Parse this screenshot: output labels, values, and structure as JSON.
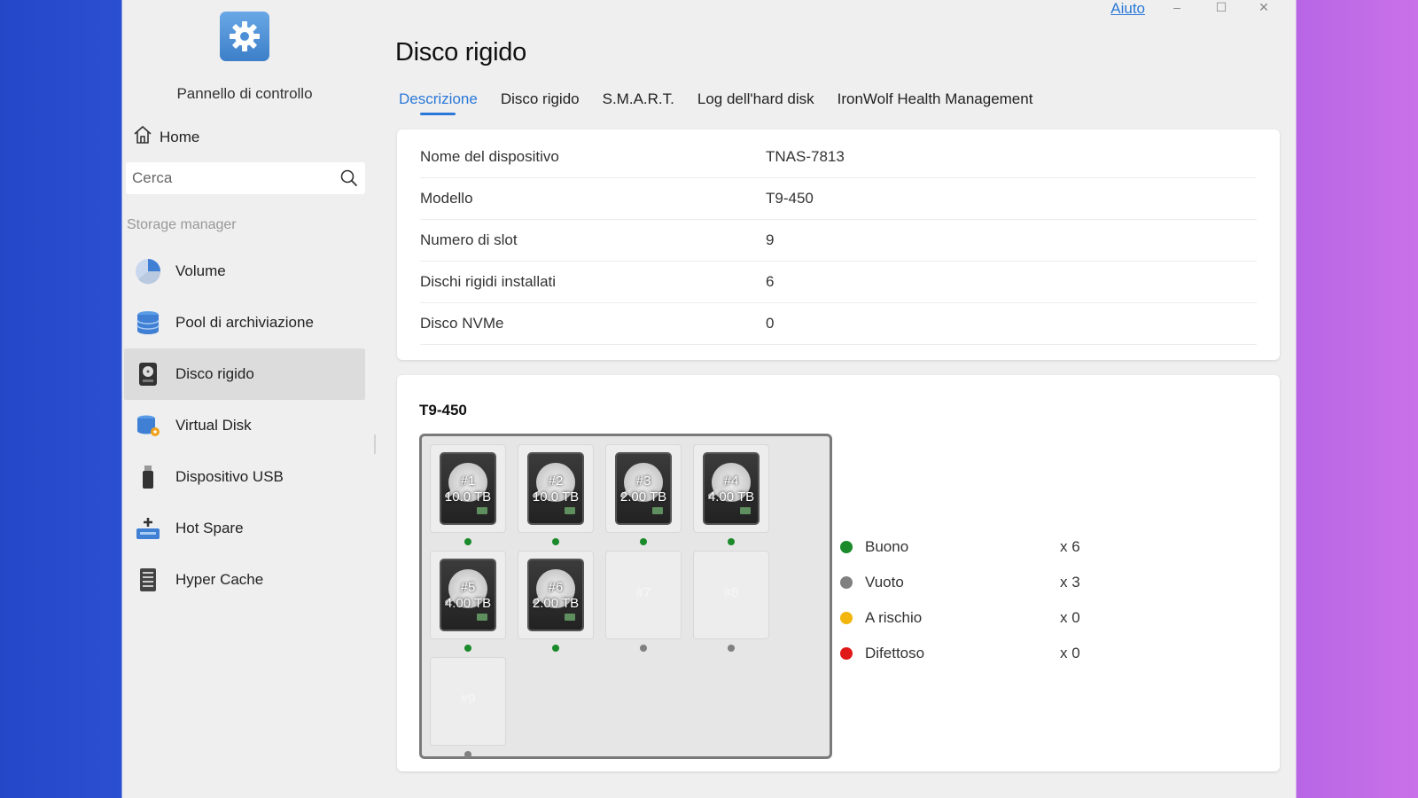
{
  "app": {
    "title": "Pannello di controllo",
    "help": "Aiuto",
    "minimize": "–",
    "maximize": "☐",
    "close": "✕"
  },
  "sidebar": {
    "home": "Home",
    "search_placeholder": "Cerca",
    "section": "Storage manager",
    "items": [
      {
        "label": "Volume",
        "icon": "pie-chart-icon"
      },
      {
        "label": "Pool di archiviazione",
        "icon": "database-icon"
      },
      {
        "label": "Disco rigido",
        "icon": "hard-disk-icon",
        "active": true
      },
      {
        "label": "Virtual Disk",
        "icon": "virtual-disk-icon"
      },
      {
        "label": "Dispositivo USB",
        "icon": "usb-icon"
      },
      {
        "label": "Hot Spare",
        "icon": "hot-spare-icon"
      },
      {
        "label": "Hyper Cache",
        "icon": "cache-icon"
      }
    ]
  },
  "main": {
    "title": "Disco rigido",
    "tabs": [
      "Descrizione",
      "Disco rigido",
      "S.M.A.R.T.",
      "Log dell'hard disk",
      "IronWolf Health Management"
    ],
    "active_tab": 0,
    "info": [
      {
        "label": "Nome del dispositivo",
        "value": "TNAS-7813"
      },
      {
        "label": "Modello",
        "value": "T9-450"
      },
      {
        "label": "Numero di slot",
        "value": "9"
      },
      {
        "label": "Dischi rigidi installati",
        "value": "6"
      },
      {
        "label": "Disco NVMe",
        "value": "0"
      }
    ],
    "enclosure": {
      "title": "T9-450",
      "slots": [
        {
          "num": "#1",
          "size": "10.0 TB",
          "status": "good"
        },
        {
          "num": "#2",
          "size": "10.0 TB",
          "status": "good"
        },
        {
          "num": "#3",
          "size": "2.00 TB",
          "status": "good"
        },
        {
          "num": "#4",
          "size": "4.00 TB",
          "status": "good"
        },
        {
          "num": "#5",
          "size": "4.00 TB",
          "status": "good"
        },
        {
          "num": "#6",
          "size": "2.00 TB",
          "status": "good"
        },
        {
          "num": "#7",
          "size": "",
          "status": "empty"
        },
        {
          "num": "#8",
          "size": "",
          "status": "empty"
        },
        {
          "num": "#9",
          "size": "",
          "status": "empty"
        }
      ]
    },
    "legend": [
      {
        "label": "Buono",
        "count": "x 6",
        "color": "#1a8a2a"
      },
      {
        "label": "Vuoto",
        "count": "x 3",
        "color": "#808080"
      },
      {
        "label": "A rischio",
        "count": "x 0",
        "color": "#f2b60c"
      },
      {
        "label": "Difettoso",
        "count": "x 0",
        "color": "#e01818"
      }
    ]
  },
  "colors": {
    "accent": "#2b78d8",
    "good": "#1a8a2a",
    "empty": "#808080"
  }
}
